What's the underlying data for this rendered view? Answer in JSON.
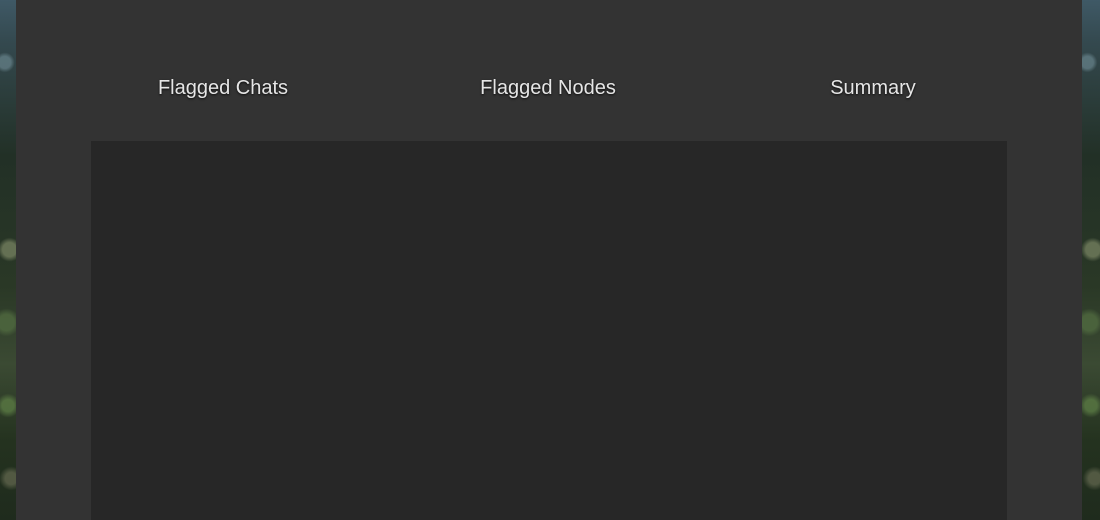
{
  "tabs": [
    {
      "label": "Flagged Chats"
    },
    {
      "label": "Flagged Nodes"
    },
    {
      "label": "Summary"
    }
  ],
  "colors": {
    "modal_background": "#333333",
    "panel_background": "#272727",
    "tab_text": "#e6e6e6"
  }
}
